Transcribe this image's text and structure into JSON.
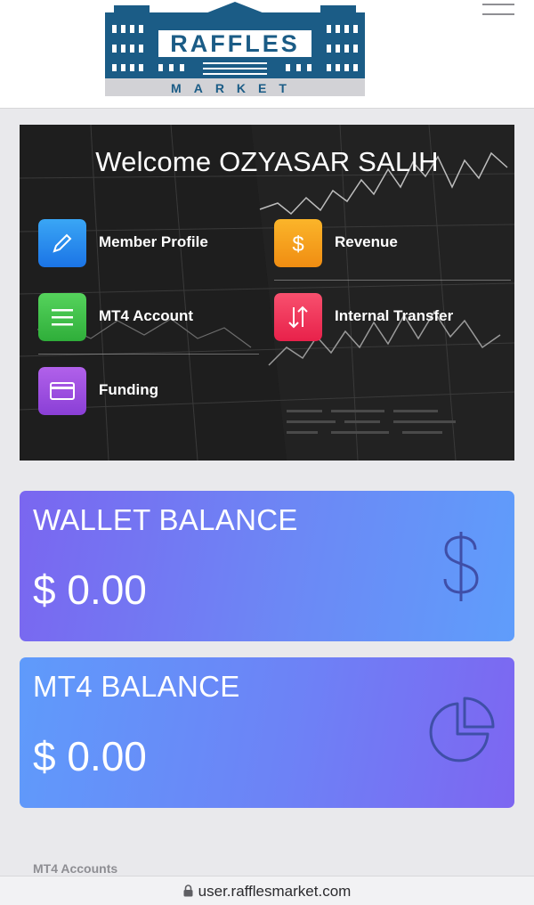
{
  "header": {
    "logo_text": "RAFFLES",
    "logo_subtext": "MARKET",
    "menu_icon": "hamburger-menu-icon"
  },
  "hero": {
    "welcome": "Welcome OZYASAR SALIH",
    "menu": [
      {
        "label": "Member Profile",
        "icon": "pencil-icon",
        "color": "#2a8df0"
      },
      {
        "label": "Revenue",
        "icon": "dollar-icon",
        "color": "#f5a11a"
      },
      {
        "label": "MT4 Account",
        "icon": "list-icon",
        "color": "#3fbf4a"
      },
      {
        "label": "Internal Transfer",
        "icon": "transfer-arrows-icon",
        "color": "#f0345a"
      },
      {
        "label": "Funding",
        "icon": "card-icon",
        "color": "#9b4fe0"
      }
    ]
  },
  "cards": {
    "wallet": {
      "title": "WALLET BALANCE",
      "amount": "$ 0.00",
      "icon": "dollar-sign-icon"
    },
    "mt4": {
      "title": "MT4 BALANCE",
      "amount": "$ 0.00",
      "icon": "pie-chart-icon"
    }
  },
  "section": {
    "mt4_accounts": "MT4 Accounts"
  },
  "browser": {
    "url": "user.rafflesmarket.com",
    "icon": "lock-icon"
  },
  "colors": {
    "accent_blue": "#1b5c86",
    "logo_grey": "#d2d2d6"
  }
}
